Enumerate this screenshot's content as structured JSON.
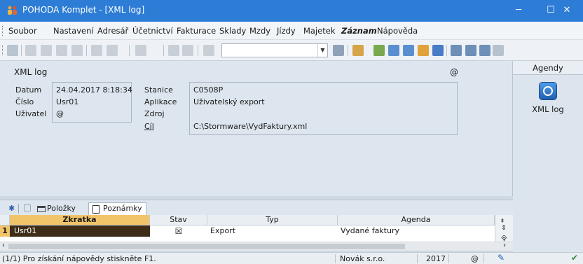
{
  "window": {
    "title": "POHODA Komplet - [XML log]",
    "minimize": "─",
    "maximize": "☐",
    "close": "✕"
  },
  "menu": [
    "Soubor",
    "Nastavení",
    "Adresář",
    "Účetnictví",
    "Fakturace",
    "Sklady",
    "Mzdy",
    "Jízdy",
    "Majetek",
    "Záznam",
    "Nápověda"
  ],
  "form": {
    "title": "XML log",
    "at": "@",
    "datum_label": "Datum",
    "datum_value": "24.04.2017 8:18:34",
    "cislo_label": "Číslo",
    "cislo_value": "Usr01",
    "uzivatel_label": "Uživatel",
    "uzivatel_value": "@",
    "stanice_label": "Stanice",
    "stanice_value": "C0508P",
    "aplikace_label": "Aplikace",
    "aplikace_value": "Uživatelský export",
    "zdroj_label": "Zdroj",
    "zdroj_value": "",
    "cil_label": "Cíl",
    "cil_value": "C:\\Stormware\\VydFaktury.xml"
  },
  "agendy": {
    "header": "Agendy",
    "item": "XML log"
  },
  "tabs": {
    "star": "✱",
    "polozky": "Položky",
    "poznamky": "Poznámky"
  },
  "grid": {
    "headers": [
      "Zkratka",
      "Stav",
      "Typ",
      "Agenda"
    ],
    "row": {
      "num": "1",
      "zkratka": "Usr01",
      "stav": "☒",
      "typ": "Export",
      "agenda": "Vydané faktury"
    }
  },
  "status": {
    "help": "(1/1) Pro získání nápovědy stiskněte F1.",
    "company": "Novák s.r.o.",
    "year": "2017",
    "at": "@"
  },
  "icons": {
    "app": "people-icon",
    "agenda": "xml-log-icon"
  },
  "colors": {
    "titlebar": "#2d7dd6",
    "selected_header": "#f2c46a",
    "selected_row": "#3e2c17",
    "form_bg": "#dde6ef"
  }
}
